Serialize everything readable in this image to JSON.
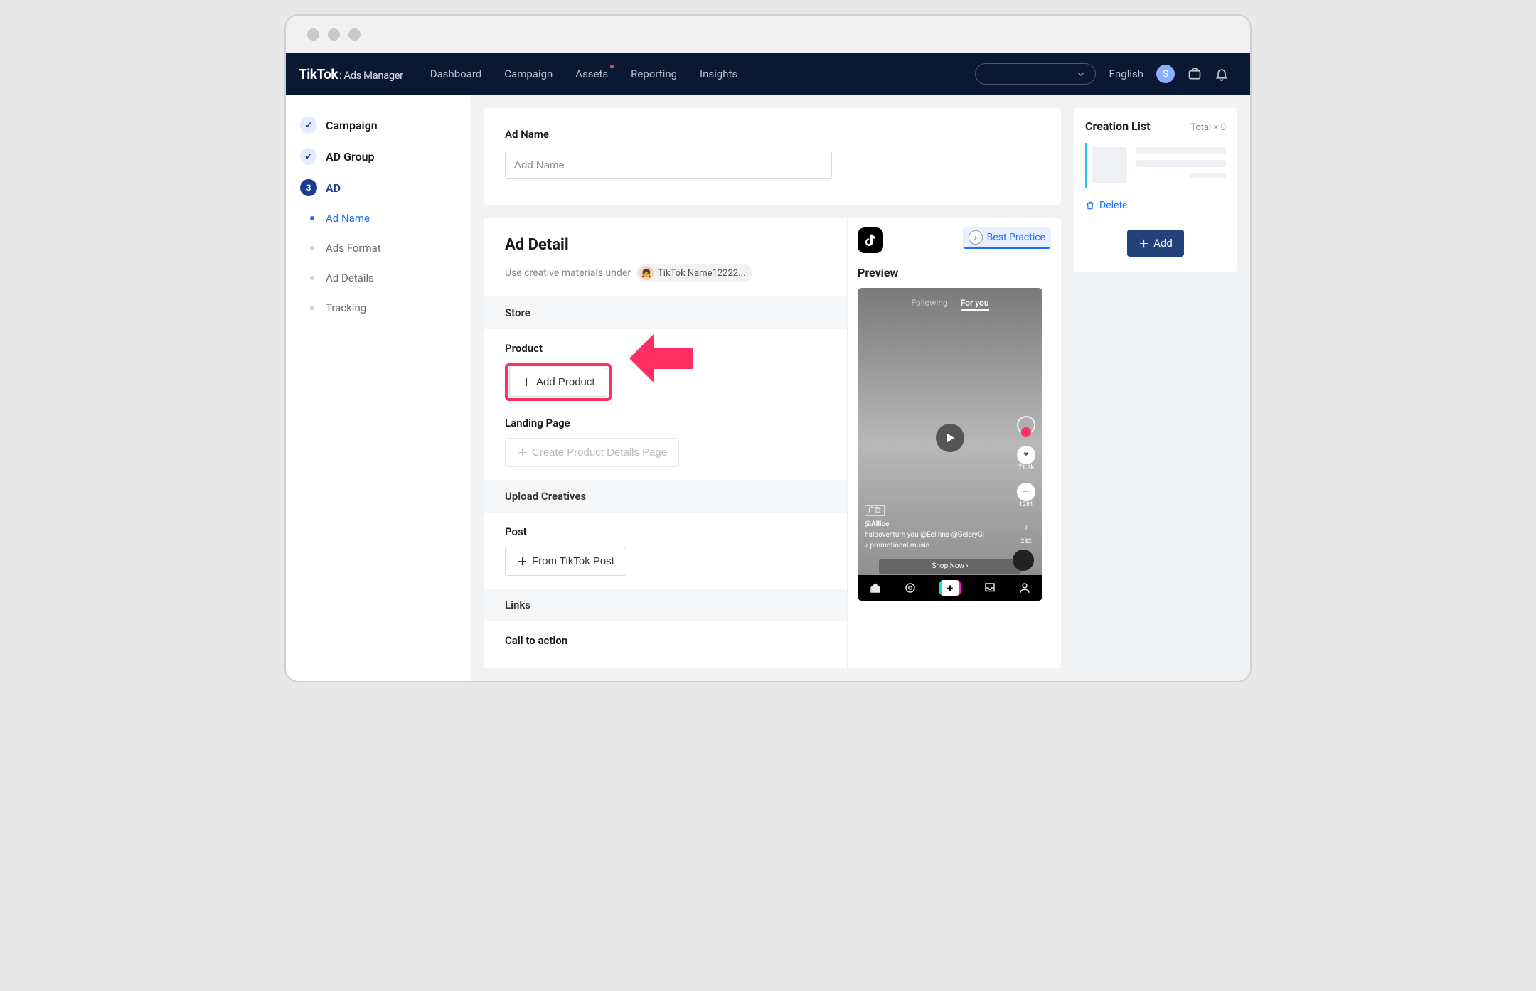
{
  "brand": {
    "name": "TikTok",
    "sub": ": Ads Manager"
  },
  "nav": {
    "items": [
      "Dashboard",
      "Campaign",
      "Assets",
      "Reporting",
      "Insights"
    ],
    "language": "English",
    "avatar_initial": "S"
  },
  "sidebar": {
    "steps": [
      {
        "label": "Campaign",
        "state": "done"
      },
      {
        "label": "AD Group",
        "state": "done"
      },
      {
        "label": "AD",
        "state": "current",
        "number": "3"
      }
    ],
    "substeps": [
      "Ad Name",
      "Ads Format",
      "Ad Details",
      "Tracking"
    ],
    "active_sub": 0
  },
  "adName": {
    "label": "Ad Name",
    "placeholder": "Add Name"
  },
  "adDetail": {
    "title": "Ad Detail",
    "subtitle": "Use creative materials under",
    "account": "TikTok Name12222...",
    "sections": {
      "store": "Store",
      "product_label": "Product",
      "add_product": "Add Product",
      "landing_label": "Landing Page",
      "create_pdp": "Create Product Details Page",
      "upload": "Upload Creatives",
      "post_label": "Post",
      "from_post": "From TikTok Post",
      "links": "Links",
      "cta": "Call to action"
    }
  },
  "preview": {
    "best_practice": "Best Practice",
    "label": "Preview",
    "tabs": {
      "following": "Following",
      "foryou": "For you"
    },
    "like_count": "71.1k",
    "comment_count": "1281",
    "share_count": "232",
    "ad_tag": "广告",
    "handle": "@Allice",
    "caption": "haloover,turn you @Eelinna @GeleryGi",
    "music": "promotional music",
    "shop_now": "Shop Now"
  },
  "creationList": {
    "title": "Creation List",
    "total_label": "Total",
    "total_count": "× 0",
    "delete": "Delete",
    "add": "Add"
  }
}
